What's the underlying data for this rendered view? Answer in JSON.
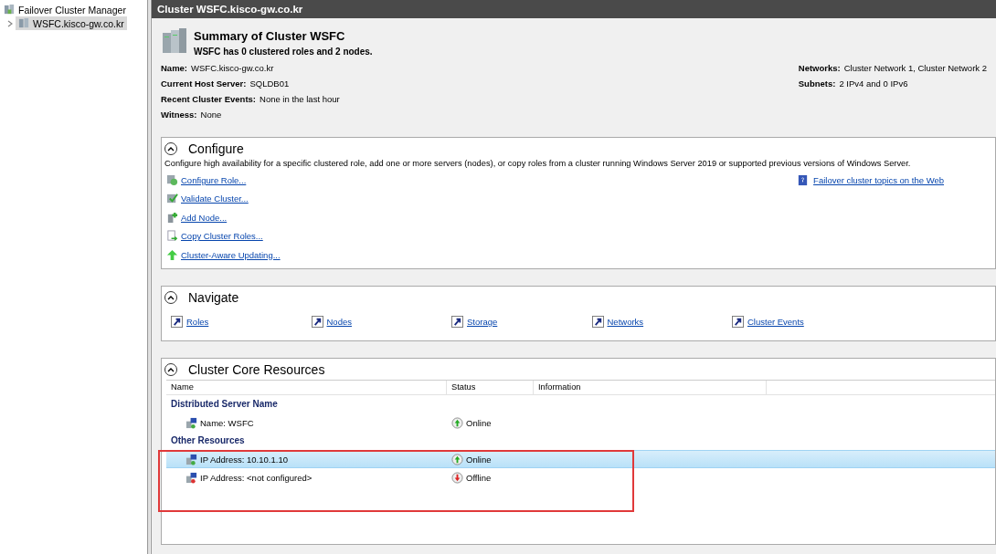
{
  "tree": {
    "root": "Failover Cluster Manager",
    "children": [
      {
        "label": "WSFC.kisco-gw.co.kr",
        "selected": true,
        "expanded": false
      }
    ]
  },
  "header": {
    "title": "Cluster WSFC.kisco-gw.co.kr"
  },
  "summary": {
    "title": "Summary of Cluster WSFC",
    "subtitle": "WSFC has 0 clustered roles and 2 nodes.",
    "left": [
      {
        "label": "Name:",
        "value": "WSFC.kisco-gw.co.kr"
      },
      {
        "label": "Current Host Server:",
        "value": "SQLDB01"
      },
      {
        "label": "Recent Cluster Events:",
        "value": "None in the last hour"
      },
      {
        "label": "Witness:",
        "value": "None"
      }
    ],
    "right": [
      {
        "label": "Networks:",
        "value": "Cluster Network 1, Cluster Network 2"
      },
      {
        "label": "Subnets:",
        "value": "2 IPv4 and 0 IPv6"
      }
    ]
  },
  "configure": {
    "title": "Configure",
    "description": "Configure high availability for a specific clustered role, add one or more servers (nodes), or copy roles from a cluster running Windows Server 2019 or supported previous versions of Windows Server.",
    "links": [
      {
        "label": "Configure Role...",
        "kind": "role"
      },
      {
        "label": "Validate Cluster...",
        "kind": "validate"
      },
      {
        "label": "Add Node...",
        "kind": "node"
      },
      {
        "label": "Copy Cluster Roles...",
        "kind": "copy"
      },
      {
        "label": "Cluster-Aware Updating...",
        "kind": "update"
      }
    ],
    "help_link": "Failover cluster topics on the Web"
  },
  "navigate": {
    "title": "Navigate",
    "links": [
      "Roles",
      "Nodes",
      "Storage",
      "Networks",
      "Cluster Events"
    ]
  },
  "core_resources": {
    "title": "Cluster Core Resources",
    "columns": [
      "Name",
      "Status",
      "Information"
    ],
    "groups": [
      {
        "name": "Distributed Server Name",
        "rows": [
          {
            "name": "Name: WSFC",
            "status": "Online",
            "kind": "online",
            "selected": false
          }
        ]
      },
      {
        "name": "Other Resources",
        "rows": [
          {
            "name": "IP Address: 10.10.1.10",
            "status": "Online",
            "kind": "online",
            "selected": true
          },
          {
            "name": "IP Address: <not configured>",
            "status": "Offline",
            "kind": "offline",
            "selected": false
          }
        ]
      }
    ]
  }
}
